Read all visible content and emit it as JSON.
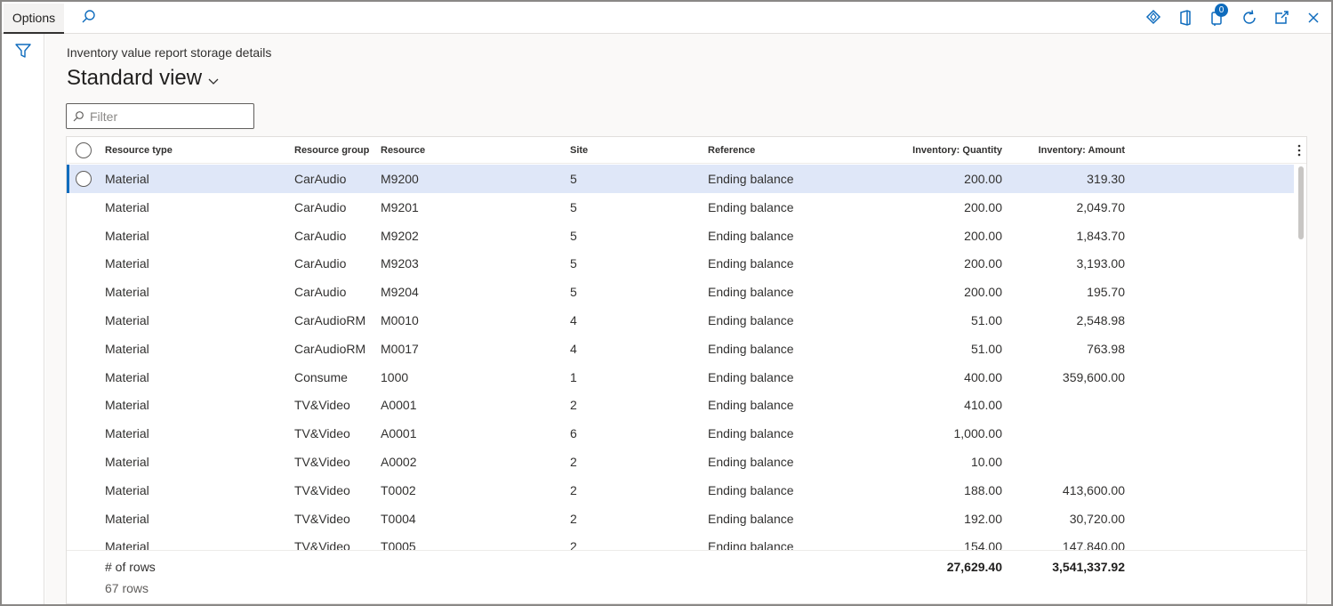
{
  "topbar": {
    "options_label": "Options",
    "notification_count": "0"
  },
  "page": {
    "caption": "Inventory value report storage details",
    "view_name": "Standard view",
    "filter_placeholder": "Filter"
  },
  "grid": {
    "columns": {
      "resource_type": "Resource type",
      "resource_group": "Resource group",
      "resource": "Resource",
      "site": "Site",
      "reference": "Reference",
      "quantity": "Inventory: Quantity",
      "amount": "Inventory: Amount"
    },
    "rows": [
      {
        "type": "Material",
        "group": "CarAudio",
        "resource": "M9200",
        "site": "5",
        "reference": "Ending balance",
        "quantity": "200.00",
        "amount": "319.30"
      },
      {
        "type": "Material",
        "group": "CarAudio",
        "resource": "M9201",
        "site": "5",
        "reference": "Ending balance",
        "quantity": "200.00",
        "amount": "2,049.70"
      },
      {
        "type": "Material",
        "group": "CarAudio",
        "resource": "M9202",
        "site": "5",
        "reference": "Ending balance",
        "quantity": "200.00",
        "amount": "1,843.70"
      },
      {
        "type": "Material",
        "group": "CarAudio",
        "resource": "M9203",
        "site": "5",
        "reference": "Ending balance",
        "quantity": "200.00",
        "amount": "3,193.00"
      },
      {
        "type": "Material",
        "group": "CarAudio",
        "resource": "M9204",
        "site": "5",
        "reference": "Ending balance",
        "quantity": "200.00",
        "amount": "195.70"
      },
      {
        "type": "Material",
        "group": "CarAudioRM",
        "resource": "M0010",
        "site": "4",
        "reference": "Ending balance",
        "quantity": "51.00",
        "amount": "2,548.98"
      },
      {
        "type": "Material",
        "group": "CarAudioRM",
        "resource": "M0017",
        "site": "4",
        "reference": "Ending balance",
        "quantity": "51.00",
        "amount": "763.98"
      },
      {
        "type": "Material",
        "group": "Consume",
        "resource": "1000",
        "site": "1",
        "reference": "Ending balance",
        "quantity": "400.00",
        "amount": "359,600.00"
      },
      {
        "type": "Material",
        "group": "TV&Video",
        "resource": "A0001",
        "site": "2",
        "reference": "Ending balance",
        "quantity": "410.00",
        "amount": ""
      },
      {
        "type": "Material",
        "group": "TV&Video",
        "resource": "A0001",
        "site": "6",
        "reference": "Ending balance",
        "quantity": "1,000.00",
        "amount": ""
      },
      {
        "type": "Material",
        "group": "TV&Video",
        "resource": "A0002",
        "site": "2",
        "reference": "Ending balance",
        "quantity": "10.00",
        "amount": ""
      },
      {
        "type": "Material",
        "group": "TV&Video",
        "resource": "T0002",
        "site": "2",
        "reference": "Ending balance",
        "quantity": "188.00",
        "amount": "413,600.00"
      },
      {
        "type": "Material",
        "group": "TV&Video",
        "resource": "T0004",
        "site": "2",
        "reference": "Ending balance",
        "quantity": "192.00",
        "amount": "30,720.00"
      },
      {
        "type": "Material",
        "group": "TV&Video",
        "resource": "T0005",
        "site": "2",
        "reference": "Ending balance",
        "quantity": "154.00",
        "amount": "147,840.00"
      }
    ],
    "footer": {
      "label": "# of rows",
      "row_count": "67 rows",
      "total_quantity": "27,629.40",
      "total_amount": "3,541,337.92"
    }
  },
  "colors": {
    "accent": "#0f6cbd",
    "selected_row": "#dfe7f8",
    "border": "#e1dfdd"
  }
}
